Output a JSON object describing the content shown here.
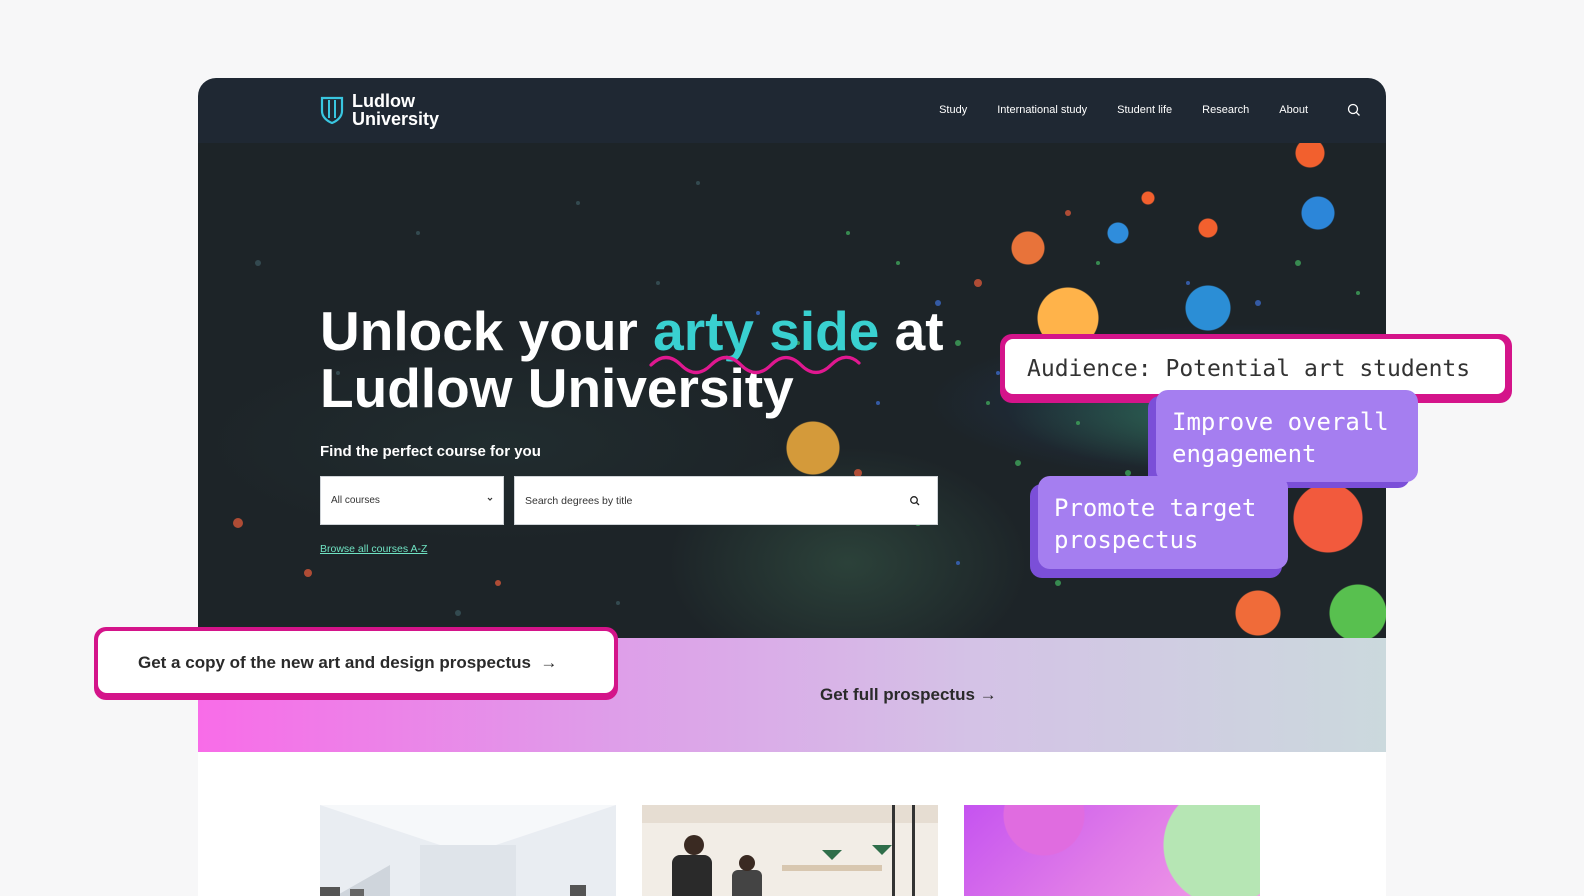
{
  "header": {
    "logo_line1": "Ludlow",
    "logo_line2": "University",
    "nav": [
      "Study",
      "International study",
      "Student life",
      "Research",
      "About"
    ]
  },
  "hero": {
    "title_part1": "Unlock your ",
    "title_accent": "arty side",
    "title_part2": " at",
    "title_line2": "Ludlow University",
    "find_label": "Find the perfect course for you",
    "select_value": "All courses",
    "search_placeholder": "Search degrees by title",
    "browse_link": "Browse all courses A-Z"
  },
  "band": {
    "link_label": "Get full prospectus",
    "arrow": "→"
  },
  "callouts": {
    "cta_label": "Get a copy of the new art and design prospectus",
    "cta_arrow": "→",
    "audience": "Audience: Potential art students",
    "goal1": "Improve overall engagement",
    "goal2": "Promote target prospectus"
  },
  "colors": {
    "nav_bg": "#1f2833",
    "accent_teal": "#39d0d0",
    "callout_magenta": "#d4148a",
    "callout_purple": "#a57ef0",
    "link_green": "#6fe3c3"
  },
  "icons": {
    "logo": "shield-logo-icon",
    "search": "search-icon",
    "chevron": "chevron-down-icon"
  }
}
